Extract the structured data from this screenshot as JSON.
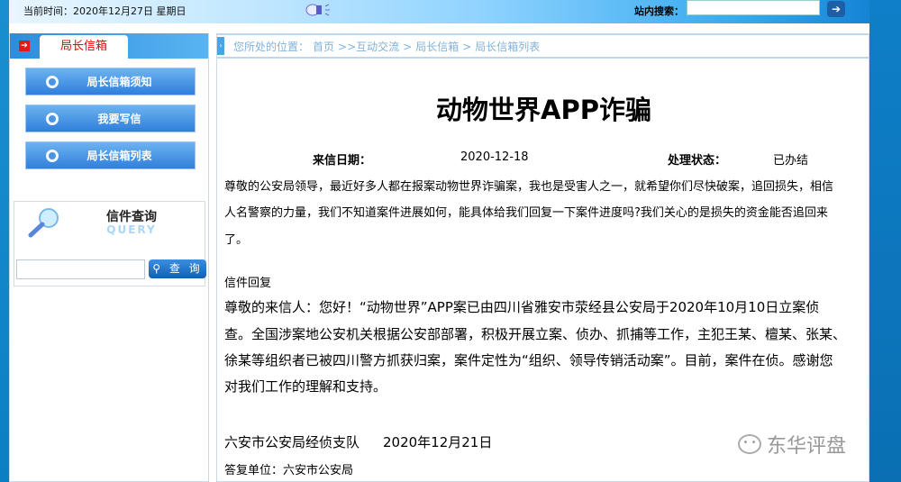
{
  "header": {
    "date": "当前时间：2020年12月27日 星期日",
    "search_label": "站内搜索：",
    "search_value": ""
  },
  "sidebar": {
    "tab": "局长信箱",
    "items": [
      {
        "label": "局长信箱须知"
      },
      {
        "label": "我要写信"
      },
      {
        "label": "局长信箱列表"
      }
    ],
    "query": {
      "title": "信件查询",
      "subtitle": "QUERY",
      "input_value": "",
      "button": "查 询"
    }
  },
  "breadcrumb": {
    "prefix": "您所处的位置：",
    "items": [
      "首页",
      ">>互动交流",
      ">",
      "局长信箱",
      ">",
      "局长信箱列表"
    ]
  },
  "letter": {
    "title": "动物世界APP诈骗",
    "date_label": "来信日期：",
    "date": "2020-12-18",
    "status_label": "处理状态：",
    "status": "已办结",
    "body_lines": [
      "尊敬的公安局领导，最近好多人都在报案动物世界诈骗案，我也是受害人之一，就希望你们尽快破案，追回损失，相信",
      "人名警察的力量，我们不知道案件进展如何，能具体给我们回复一下案件进度吗?我们关心的是损失的资金能否追回来",
      "了。"
    ]
  },
  "reply": {
    "heading": "信件回复",
    "lines": [
      "尊敬的来信人：您好！“动物世界”APP案已由四川省雅安市荥经县公安局于2020年10月10日立案侦",
      "查。全国涉案地公安机关根据公安部部署，积极开展立案、侦办、抓捕等工作，主犯王某、檀某、张某、",
      "徐某等组织者已被四川警方抓获归案，案件定性为“组织、领导传销活动案”。目前，案件在侦。感谢您",
      "对我们工作的理解和支持。"
    ],
    "signature": "六安市公安局经侦支队",
    "sign_date": "2020年12月21日",
    "unit": "答复单位：六安市公安局"
  },
  "watermark": "东华评盘"
}
